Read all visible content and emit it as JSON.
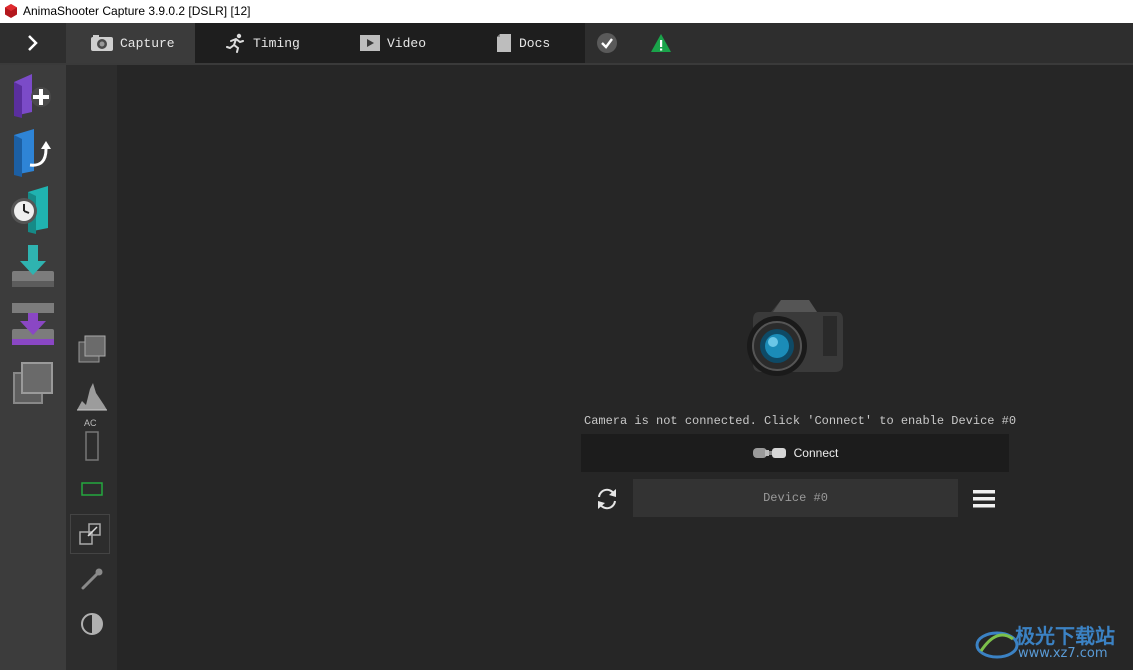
{
  "window": {
    "title": "AnimaShooter Capture 3.9.0.2 [DSLR] [12]"
  },
  "topbar": {
    "expand_glyph": "›",
    "tabs": [
      {
        "label": "Capture",
        "icon": "camera-icon",
        "active": true
      },
      {
        "label": "Timing",
        "icon": "running-man-icon",
        "active": false
      },
      {
        "label": "Video",
        "icon": "play-icon",
        "active": false
      },
      {
        "label": "Docs",
        "icon": "document-icon",
        "active": false
      }
    ],
    "status_icons": [
      "check-icon",
      "warning-icon"
    ]
  },
  "left_sidebar": {
    "buttons": [
      "new-project-icon",
      "open-project-icon",
      "recent-project-icon",
      "import-icon",
      "export-icon",
      "windows-icon"
    ]
  },
  "toolstrip": {
    "ac_label": "AC",
    "tools": [
      "overlay-icon",
      "histogram-icon",
      "ac-meter-icon",
      "frame-rect-icon",
      "resize-icon",
      "eyedropper-icon",
      "contrast-icon"
    ]
  },
  "main": {
    "status_message": "Camera is not connected. Click 'Connect' to enable Device #0",
    "connect_label": "Connect",
    "device_label": "Device #0"
  },
  "watermark": {
    "line1": "极光下载站",
    "line2": "www.xz7.com"
  },
  "colors": {
    "background": "#262626",
    "sidebar": "#3c3c3c",
    "active_tab": "#3b3b3b",
    "warning_green": "#1aa34a"
  }
}
